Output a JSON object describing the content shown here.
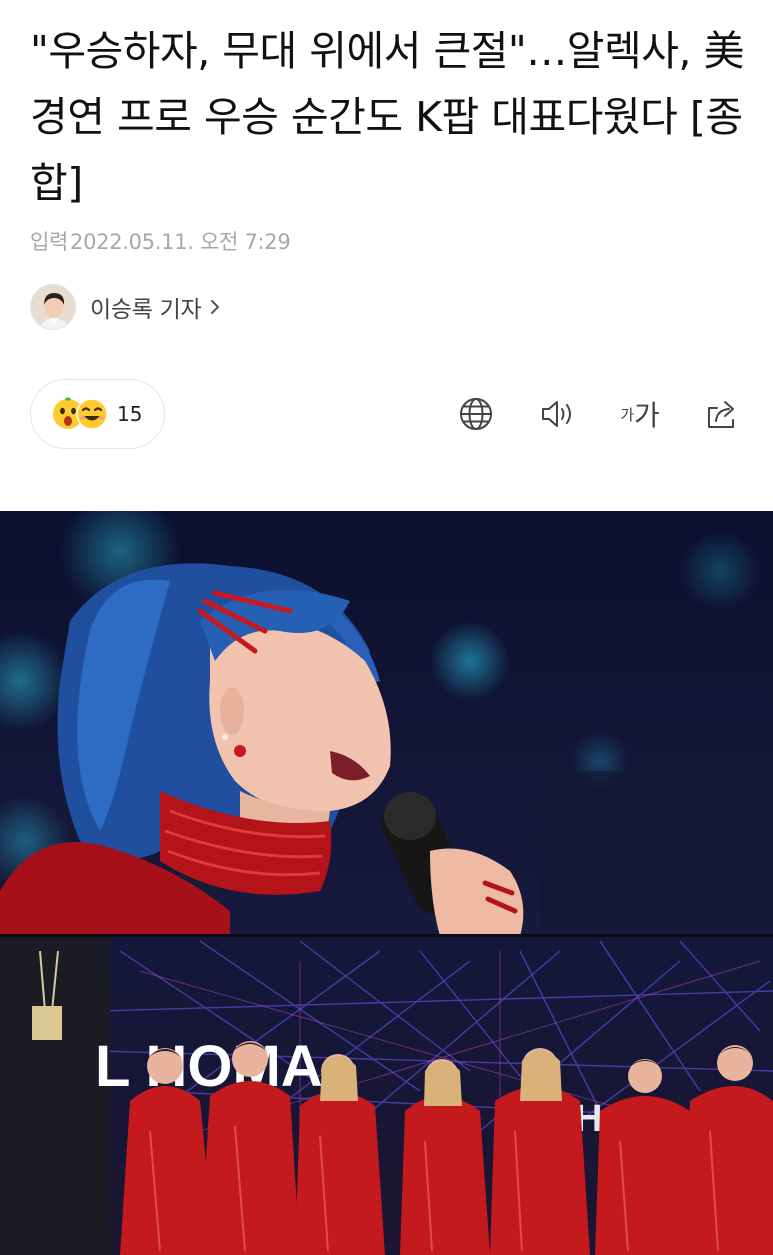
{
  "article": {
    "title": "\"우승하자, 무대 위에서 큰절\"…알렉사, 美 경연 프로 우승 순간도 K팝 대표다웠다 [종합]",
    "input_label": "입력",
    "date": "2022.05.11. 오전 7:29"
  },
  "reporter": {
    "name": "이승록 기자",
    "chevron_icon": "chevron-right-icon"
  },
  "reactions": {
    "count": "15",
    "emojis": [
      "surprised-face-icon",
      "smiling-face-icon"
    ]
  },
  "toolbar": {
    "icons": [
      "globe-icon",
      "speaker-icon",
      "font-size-icon",
      "share-icon"
    ],
    "font_small": "가",
    "font_large": "가"
  },
  "photo": {
    "stage_text_left": "L  HOMA",
    "stage_text_right": "HOM"
  },
  "colors": {
    "text": "#111111",
    "meta": "#a7a7a7",
    "border": "#e6e6e6",
    "icon": "#444444"
  }
}
